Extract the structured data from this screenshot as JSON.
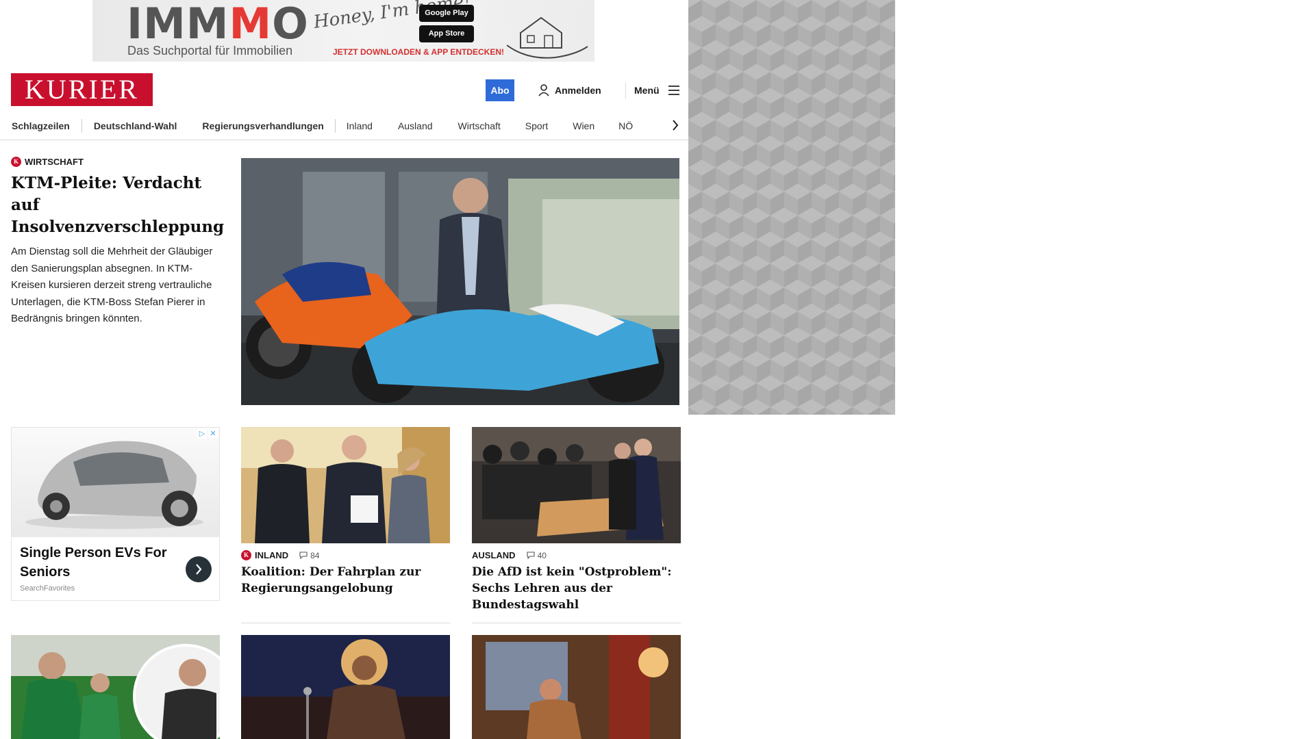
{
  "banner": {
    "logo_a": "IMM",
    "logo_m": "M",
    "logo_b": "O",
    "tagline": "Das Suchportal für Immobilien",
    "script": "Honey, I'm home!",
    "google_play": "Google Play",
    "app_store": "App Store",
    "cta": "JETZT DOWNLOADEN & APP ENTDECKEN!"
  },
  "header": {
    "logo": "KURIER",
    "abo": "Abo",
    "login": "Anmelden",
    "menu": "Menü"
  },
  "nav": {
    "items": [
      "Schlagzeilen",
      "Deutschland-Wahl",
      "Regierungsverhandlungen",
      "Inland",
      "Ausland",
      "Wirtschaft",
      "Sport",
      "Wien",
      "NÖ"
    ]
  },
  "hero": {
    "kicker": "WIRTSCHAFT",
    "title": "KTM-Pleite: Verdacht auf Insolvenzverschleppung",
    "teaser": "Am Dienstag soll die Mehrheit der Gläubiger den Sanierungsplan absegnen. In KTM-Kreisen kursieren derzeit streng vertrauliche Unterlagen, die KTM-Boss Stefan Pierer in Bedrängnis bringen könnten.",
    "image": "Man in suit standing behind two racing motorcycles"
  },
  "ad": {
    "title": "Single Person EVs For Seniors",
    "source": "SearchFavorites"
  },
  "cards": [
    {
      "kicker": "INLAND",
      "comments": "84",
      "title": "Koalition: Der Fahrplan zur Regierungsangelobung"
    },
    {
      "kicker": "AUSLAND",
      "comments": "40",
      "title": "Die AfD ist kein \"Ostproblem\": Sechs Lehren aus der Bundestagswahl"
    }
  ],
  "colors": {
    "brand": "#c8102e",
    "abo": "#2f6bd8"
  }
}
